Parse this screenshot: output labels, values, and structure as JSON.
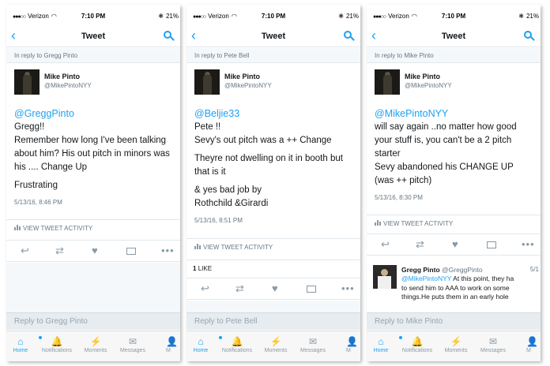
{
  "colors": {
    "accent": "#1da1f2",
    "secondary_text": "#657786",
    "background": "#ffffff",
    "divider": "#e1e8ed",
    "reply_bar": "#e6ecf0"
  },
  "phones": [
    {
      "status": {
        "carrier": "Verizon",
        "time": "7:10 PM",
        "battery": "21%"
      },
      "nav_title": "Tweet",
      "reply_banner": "In reply to Gregg Pinto",
      "author": {
        "name": "Mike Pinto",
        "handle": "@MikePintoNYY"
      },
      "tweet": {
        "mention": "@GreggPinto",
        "lines": [
          "Gregg!!",
          "Remember how long I've been talking",
          "about him? His out pitch in minors was",
          "his .... Change Up"
        ],
        "lines2": [
          "Frustrating"
        ],
        "timestamp": "5/13/16, 8:46 PM"
      },
      "activity_label": "VIEW TWEET ACTIVITY",
      "reply_placeholder": "Reply to Gregg Pinto"
    },
    {
      "status": {
        "carrier": "Verizon",
        "time": "7:10 PM",
        "battery": "21%"
      },
      "nav_title": "Tweet",
      "reply_banner": "In reply to Pete Bell",
      "author": {
        "name": "Mike Pinto",
        "handle": "@MikePintoNYY"
      },
      "tweet": {
        "mention": "@Beljie33",
        "lines": [
          "Pete !!",
          "Sevy's out pitch was a ++ Change"
        ],
        "lines2": [
          "Theyre not dwelling on it in booth but",
          "that is it"
        ],
        "lines3": [
          "& yes bad job by",
          "Rothchild &Girardi"
        ],
        "timestamp": "5/13/16, 8:51 PM"
      },
      "activity_label": "VIEW TWEET ACTIVITY",
      "likes": {
        "count": "1",
        "label": "LIKE"
      },
      "reply_placeholder": "Reply to Pete Bell"
    },
    {
      "status": {
        "carrier": "Verizon",
        "time": "7:10 PM",
        "battery": "21%"
      },
      "nav_title": "Tweet",
      "reply_banner": "In reply to Mike Pinto",
      "author": {
        "name": "Mike Pinto",
        "handle": "@MikePintoNYY"
      },
      "tweet": {
        "mention": "@MikePintoNYY",
        "lines": [
          "will say again ..no matter how good",
          "your stuff is, you can't be a 2 pitch",
          "starter",
          "Sevy abandoned his CHANGE UP",
          "(was ++ pitch)"
        ],
        "timestamp": "5/13/16, 8:30 PM"
      },
      "activity_label": "VIEW TWEET ACTIVITY",
      "related": {
        "name": "Gregg Pinto",
        "handle": "@GreggPinto",
        "date": "5/1",
        "mention": "@MikePintoNYY",
        "line1_rest": " At this point, they ha",
        "line2": "to send him to AAA to work on some",
        "line3": "things.He puts them in an early hole"
      },
      "reply_placeholder": "Reply to Mike Pinto"
    }
  ],
  "tabs": [
    {
      "label": "Home",
      "icon": "home-icon",
      "glyph": "⌂"
    },
    {
      "label": "Notifications",
      "icon": "bell-icon",
      "glyph": "🔔"
    },
    {
      "label": "Moments",
      "icon": "lightning-icon",
      "glyph": "⚡"
    },
    {
      "label": "Messages",
      "icon": "envelope-icon",
      "glyph": "✉"
    },
    {
      "label": "M",
      "icon": "person-icon",
      "glyph": "👤"
    }
  ],
  "actions": [
    {
      "icon": "reply-icon",
      "glyph": "↩"
    },
    {
      "icon": "retweet-icon",
      "glyph": "⇄"
    },
    {
      "icon": "heart-icon",
      "glyph": "♥"
    },
    {
      "icon": "direct-message-icon",
      "glyph": ""
    },
    {
      "icon": "more-icon",
      "glyph": "•••"
    }
  ]
}
